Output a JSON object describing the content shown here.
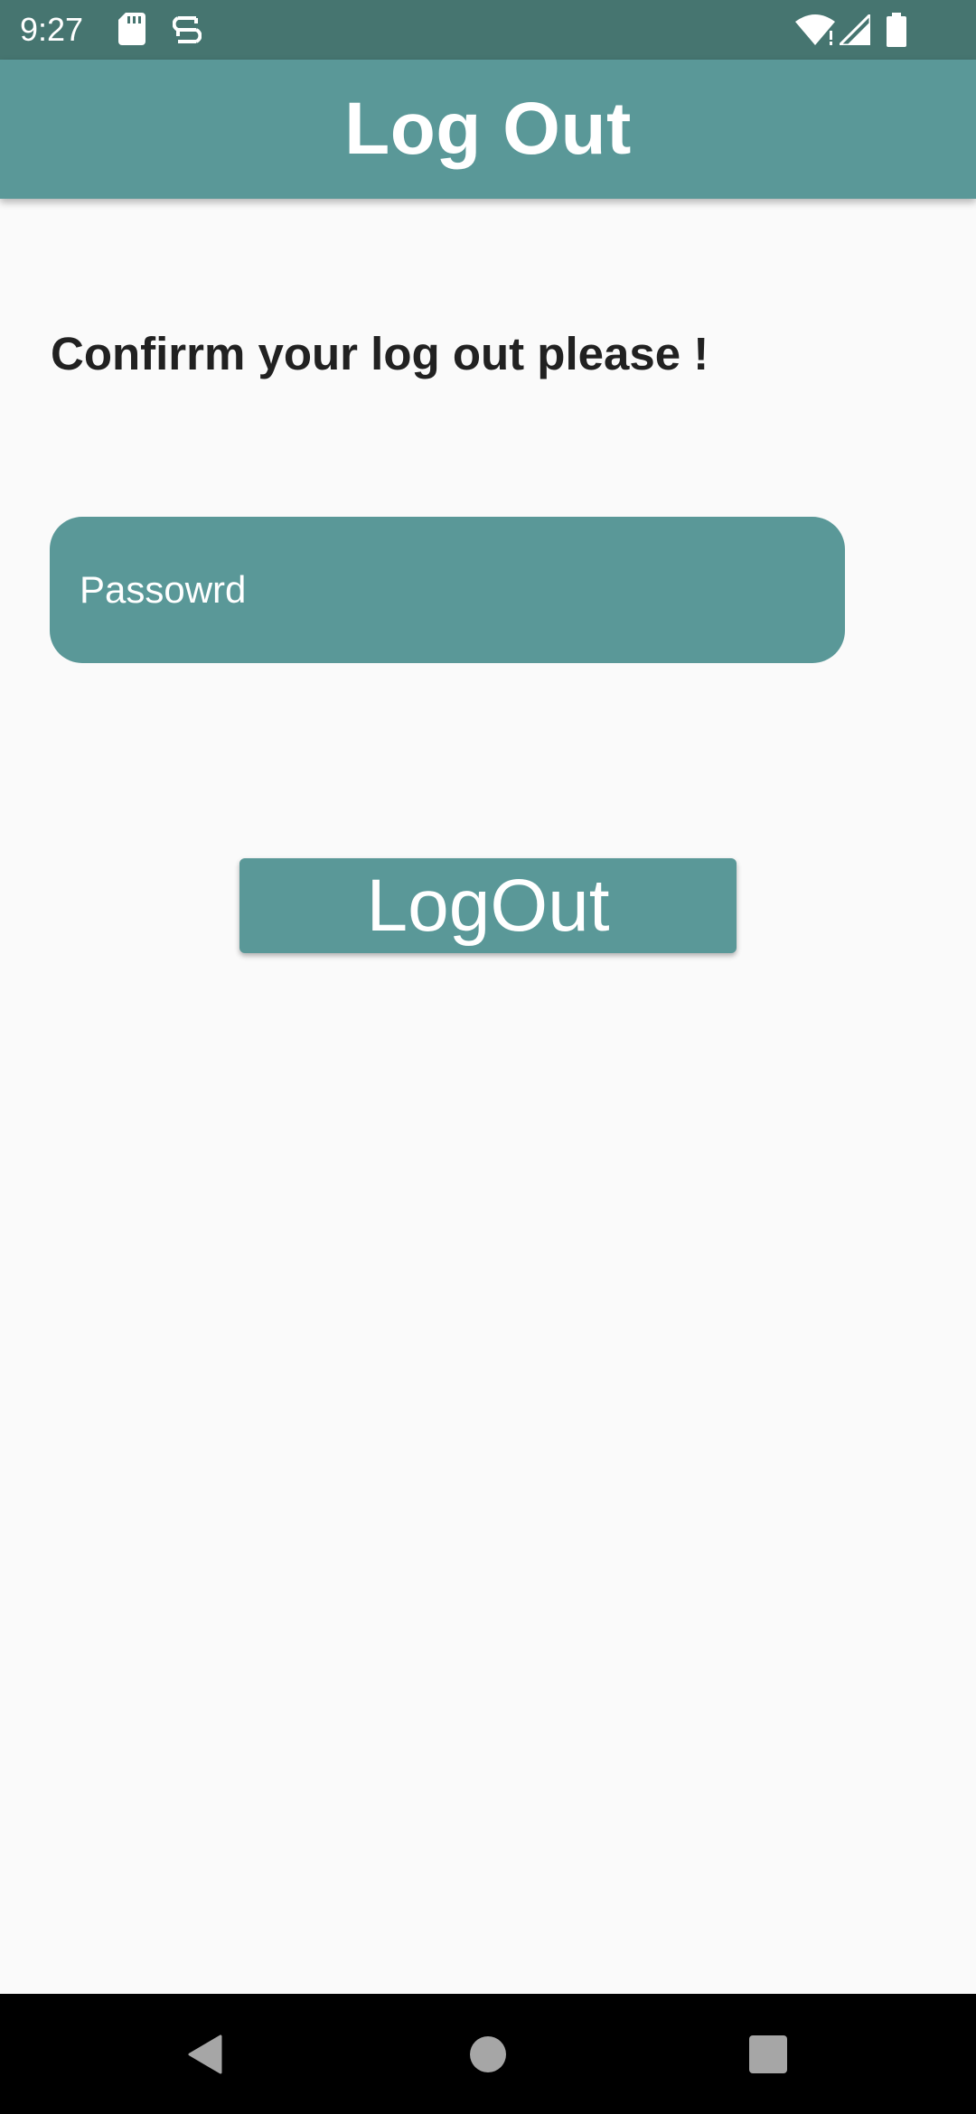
{
  "status_bar": {
    "time": "9:27",
    "icons_left": [
      "sd-card-icon",
      "sync-icon"
    ],
    "icons_right": [
      "wifi-icon",
      "cell-signal-icon",
      "battery-icon"
    ]
  },
  "app_bar": {
    "title": "Log Out"
  },
  "content": {
    "prompt": "Confirrm your log out please !",
    "password_field": {
      "placeholder": "Passowrd",
      "value": ""
    },
    "logout_button_label": "LogOut"
  },
  "nav_bar": {
    "buttons": [
      "back-icon",
      "home-icon",
      "recents-icon"
    ]
  },
  "colors": {
    "status_bar": "#467570",
    "accent": "#5a9898",
    "background": "#fafafa",
    "text": "#212121"
  }
}
